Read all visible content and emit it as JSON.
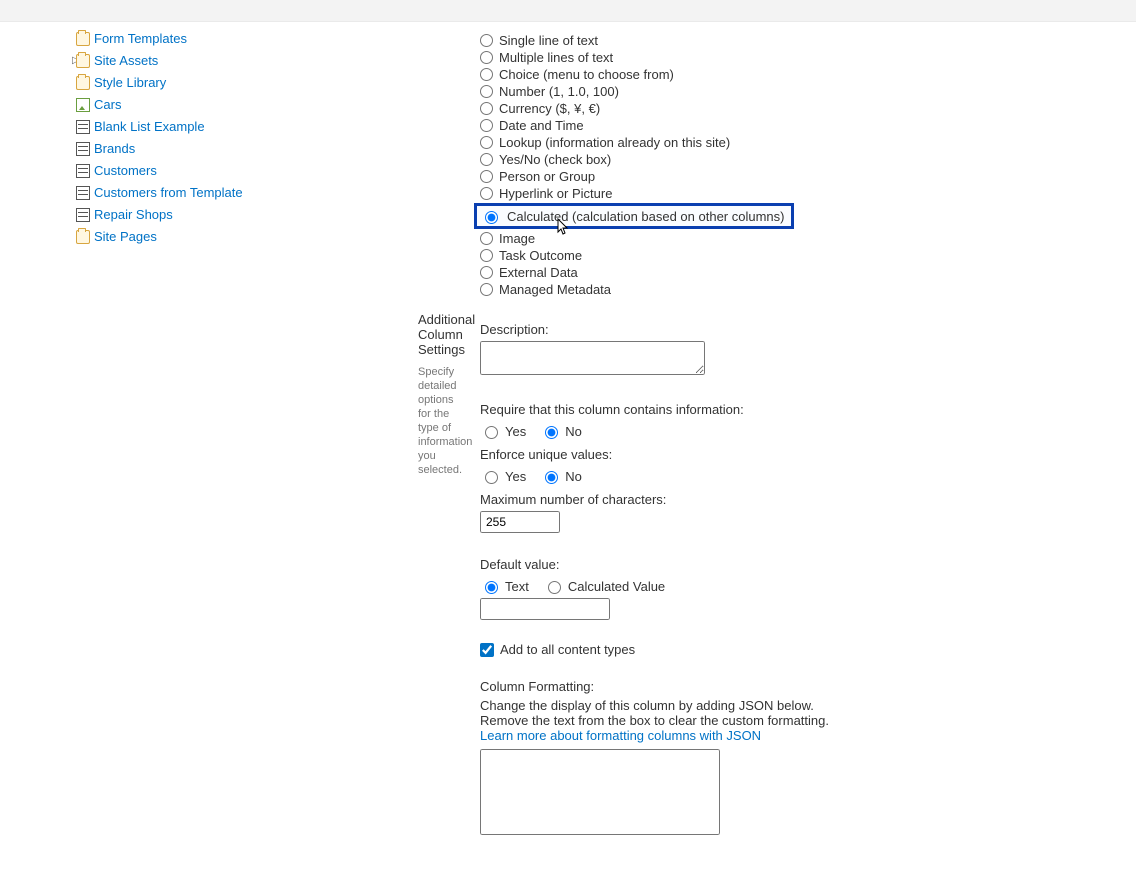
{
  "sidebar": {
    "items": [
      {
        "label": "Form Templates",
        "icon": "folder"
      },
      {
        "label": "Site Assets",
        "icon": "folder",
        "expandable": true
      },
      {
        "label": "Style Library",
        "icon": "folder"
      },
      {
        "label": "Cars",
        "icon": "image"
      },
      {
        "label": "Blank List Example",
        "icon": "list"
      },
      {
        "label": "Brands",
        "icon": "list"
      },
      {
        "label": "Customers",
        "icon": "list"
      },
      {
        "label": "Customers from Template",
        "icon": "list"
      },
      {
        "label": "Repair Shops",
        "icon": "list"
      },
      {
        "label": "Site Pages",
        "icon": "folder"
      }
    ]
  },
  "column_types": {
    "options": [
      "Single line of text",
      "Multiple lines of text",
      "Choice (menu to choose from)",
      "Number (1, 1.0, 100)",
      "Currency ($, ¥, €)",
      "Date and Time",
      "Lookup (information already on this site)",
      "Yes/No (check box)",
      "Person or Group",
      "Hyperlink or Picture",
      "Calculated (calculation based on other columns)",
      "Image",
      "Task Outcome",
      "External Data",
      "Managed Metadata"
    ],
    "selected_index": 10
  },
  "additional": {
    "heading": "Additional Column Settings",
    "sub": "Specify detailed options for the type of information you selected.",
    "description_label": "Description:",
    "require_label": "Require that this column contains information:",
    "require_yes": "Yes",
    "require_no": "No",
    "require_selected": "No",
    "enforce_label": "Enforce unique values:",
    "enforce_yes": "Yes",
    "enforce_no": "No",
    "enforce_selected": "No",
    "maxchars_label": "Maximum number of characters:",
    "maxchars_value": "255",
    "default_label": "Default value:",
    "default_text": "Text",
    "default_calc": "Calculated Value",
    "default_selected": "Text",
    "default_input": "",
    "add_content_types": "Add to all content types",
    "formatting_heading": "Column Formatting:",
    "formatting_line1": "Change the display of this column by adding JSON below.",
    "formatting_line2": "Remove the text from the box to clear the custom formatting.",
    "formatting_link": "Learn more about formatting columns with JSON"
  }
}
